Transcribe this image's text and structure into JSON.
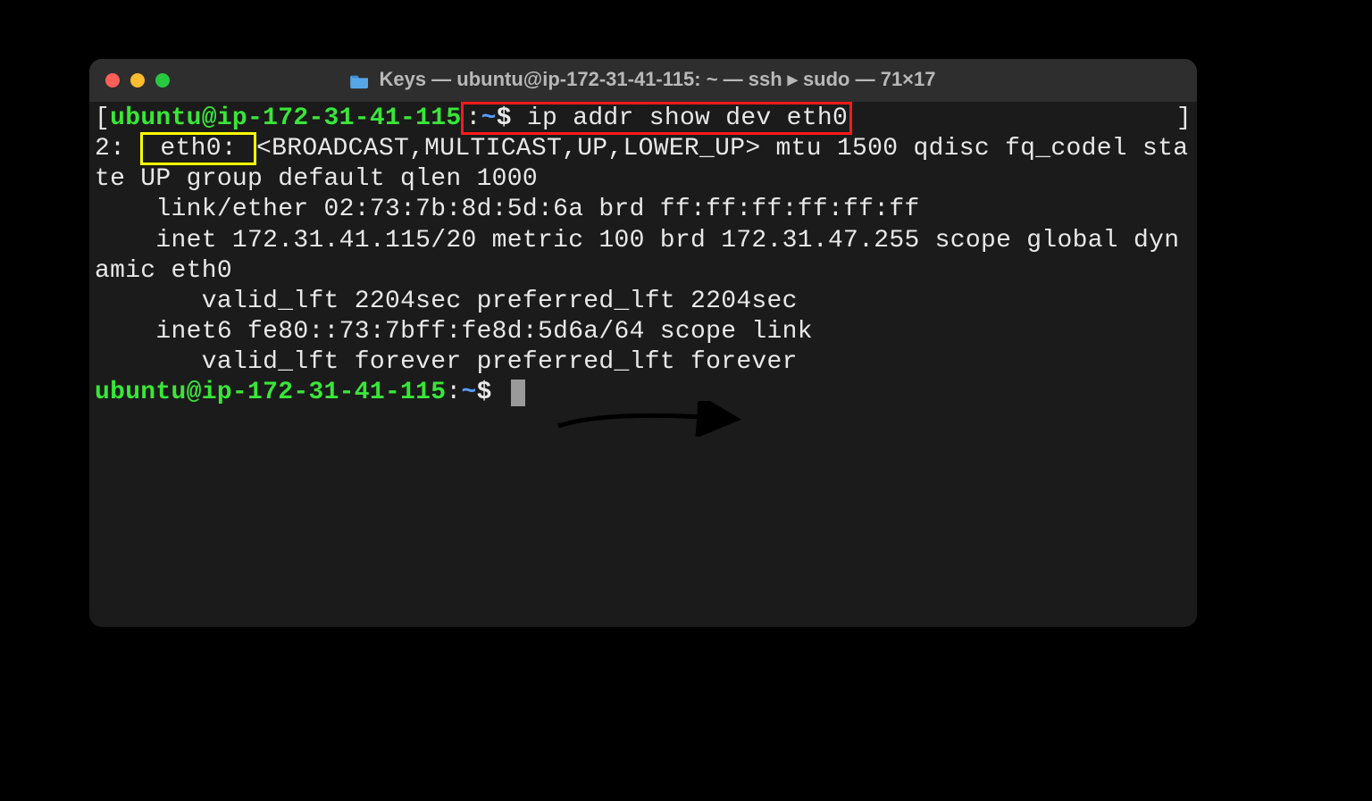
{
  "window": {
    "title": "Keys — ubuntu@ip-172-31-41-115: ~ — ssh ▸ sudo — 71×17",
    "folder_icon_name": "folder-icon"
  },
  "traffic": {
    "red": "close",
    "yellow": "minimize",
    "green": "zoom"
  },
  "prompt1": {
    "bracket_open": "[",
    "user_host": "ubuntu@ip-172-31-41-115",
    "colon": ":",
    "path": "~",
    "dollar": "$",
    "command": " ip addr show dev eth0",
    "bracket_close": "]"
  },
  "output": {
    "l1_pre": "2: ",
    "l1_eth": " eth0: ",
    "l1_rest": "<BROADCAST,MULTICAST,UP,LOWER_UP> mtu 1500 qdisc fq_codel state UP group default qlen 1000",
    "l2": "    link/ether 02:73:7b:8d:5d:6a brd ff:ff:ff:ff:ff:ff",
    "l3": "    inet 172.31.41.115/20 metric 100 brd 172.31.47.255 scope global dynamic eth0",
    "l4": "       valid_lft 2204sec preferred_lft 2204sec",
    "l5": "    inet6 fe80::73:7bff:fe8d:5d6a/64 scope link",
    "l6": "       valid_lft forever preferred_lft forever"
  },
  "prompt2": {
    "user_host": "ubuntu@ip-172-31-41-115",
    "colon": ":",
    "path": "~",
    "dollar": "$"
  }
}
